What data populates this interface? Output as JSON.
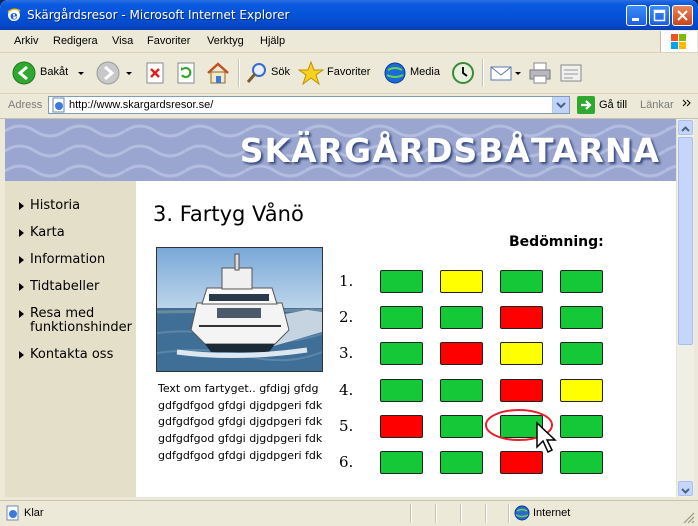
{
  "window": {
    "title": "Skärgårdsresor - Microsoft Internet Explorer"
  },
  "menu": [
    "Arkiv",
    "Redigera",
    "Visa",
    "Favoriter",
    "Verktyg",
    "Hjälp"
  ],
  "toolbar": {
    "back_label": "Bakåt",
    "search_label": "Sök",
    "favorites_label": "Favoriter",
    "media_label": "Media"
  },
  "address": {
    "label": "Adress",
    "url": "http://www.skargardsresor.se/",
    "go_label": "Gå till",
    "links_label": "Länkar"
  },
  "page": {
    "banner_title": "SKÄRGÅRDSBÅTARNA",
    "nav": [
      {
        "label": "Historia"
      },
      {
        "label": "Karta"
      },
      {
        "label": "Information"
      },
      {
        "label": "Tidtabeller"
      },
      {
        "label": "Resa med",
        "label2": "funktionshinder"
      },
      {
        "label": "Kontakta oss"
      }
    ],
    "heading": "3. Fartyg Vånö",
    "description": [
      "Text om fartyget.. gfdigj gfdg",
      "gdfgdfgod gfdgi djgdpgeri fdk",
      "gdfgdfgod gfdgi djgdpgeri fdk",
      "gdfgdfgod gfdgi djgdpgeri fdk",
      "gdfgdfgod gfdgi djgdpgeri fdk"
    ],
    "rating_title": "Bedömning:",
    "rating_rows": [
      {
        "num": "1.",
        "cells": [
          "green",
          "yellow",
          "green",
          "green"
        ]
      },
      {
        "num": "2.",
        "cells": [
          "green",
          "green",
          "red",
          "green"
        ]
      },
      {
        "num": "3.",
        "cells": [
          "green",
          "red",
          "yellow",
          "green"
        ]
      },
      {
        "num": "4.",
        "cells": [
          "green",
          "green",
          "red",
          "yellow"
        ]
      },
      {
        "num": "5.",
        "cells": [
          "red",
          "green",
          "green",
          "green"
        ]
      },
      {
        "num": "6.",
        "cells": [
          "green",
          "green",
          "red",
          "green"
        ]
      }
    ],
    "colors": {
      "green": "#14c837",
      "yellow": "#ffff00",
      "red": "#ff0000",
      "highlight": "#e8202a"
    },
    "highlighted_cell": "row 5, column 3"
  },
  "status": {
    "text": "Klar",
    "zone": "Internet"
  }
}
